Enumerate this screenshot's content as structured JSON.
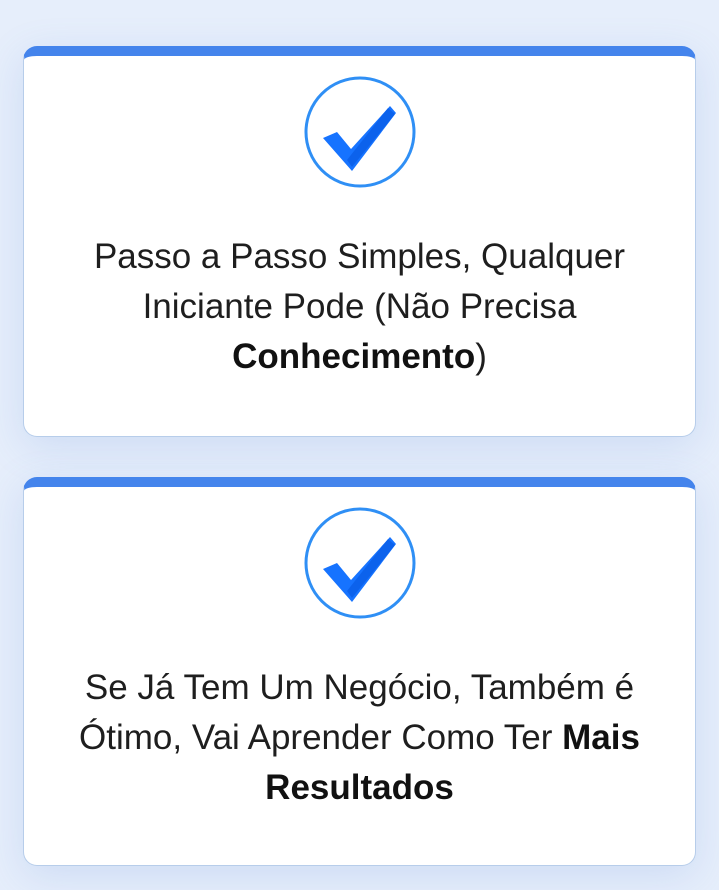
{
  "theme": {
    "accent": "#4484ec",
    "check_blue": "#1673ff",
    "card_border": "#b7cdea",
    "background": "#e6eefb"
  },
  "cards": [
    {
      "icon": "checkmark-circle-icon",
      "text_before": "Passo a Passo Simples, Qualquer Iniciante Pode (Não Precisa ",
      "text_bold": "Conhecimento",
      "text_after": ")"
    },
    {
      "icon": "checkmark-circle-icon",
      "text_before": "Se Já Tem Um Negócio, Também é Ótimo, Vai Aprender Como Ter ",
      "text_bold": "Mais Resultados",
      "text_after": ""
    }
  ]
}
